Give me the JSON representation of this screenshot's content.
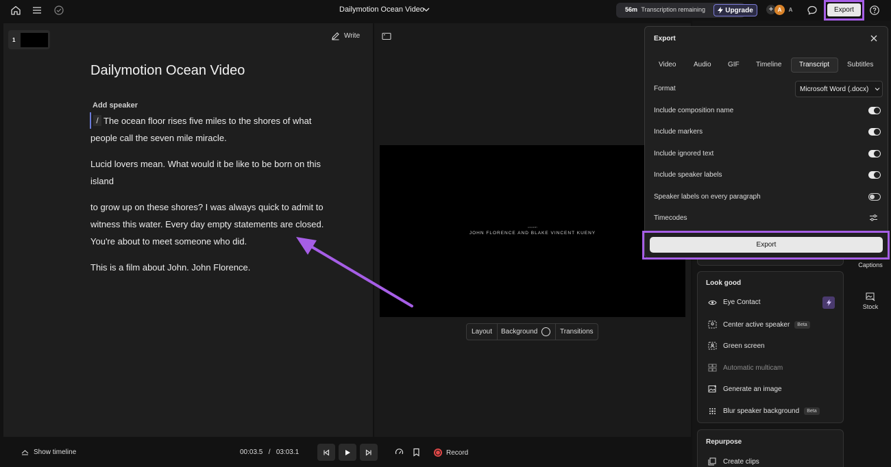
{
  "topbar": {
    "title": "Dailymotion Ocean Video",
    "transcription_minutes": "56m",
    "transcription_label": "Transcription remaining",
    "upgrade_label": "Upgrade",
    "avatar_plus": "+",
    "avatar_1": "A",
    "avatar_2": "A",
    "export_label": "Export",
    "icons": [
      "home-icon",
      "menu-icon",
      "check-circle-icon",
      "chevron-down-icon",
      "comment-icon",
      "help-icon"
    ]
  },
  "editor": {
    "scene_number": "1",
    "write_label": "Write",
    "title": "Dailymotion Ocean Video",
    "add_speaker": "Add speaker",
    "slash": "/",
    "paragraphs": [
      "The ocean floor rises five miles to the shores of what people call the seven mile miracle.",
      "Lucid lovers mean. What would it be like to be born on this island",
      "to grow up on these shores? I was always quick to admit to witness this water. Every day empty statements are closed. You're about to meet someone who did.",
      "This is a film about John. John Florence."
    ]
  },
  "preview": {
    "video_caption": "JOHN FLORENCE AND BLAKE VINCENT KUENY",
    "video_small_text": "A FILM BY",
    "toolbar": {
      "layout": "Layout",
      "background": "Background",
      "transitions": "Transitions"
    }
  },
  "bottombar": {
    "show_timeline": "Show timeline",
    "current_time": "00:03.5",
    "separator": "/",
    "total_time": "03:03.1",
    "record_label": "Record"
  },
  "export_panel": {
    "title": "Export",
    "tabs": [
      "Video",
      "Audio",
      "GIF",
      "Timeline",
      "Transcript",
      "Subtitles"
    ],
    "active_tab": "Transcript",
    "format_label": "Format",
    "format_value": "Microsoft Word (.docx)",
    "options": [
      {
        "label": "Include composition name",
        "on": true
      },
      {
        "label": "Include markers",
        "on": true
      },
      {
        "label": "Include ignored text",
        "on": true
      },
      {
        "label": "Include speaker labels",
        "on": true
      },
      {
        "label": "Speaker labels on every paragraph",
        "on": false
      }
    ],
    "timecodes_label": "Timecodes",
    "export_button": "Export"
  },
  "sidebar": {
    "look_good_title": "Look good",
    "look_good_items": [
      {
        "label": "Eye Contact",
        "icon": "eye-icon",
        "badge": ""
      },
      {
        "label": "Center active speaker",
        "icon": "speaker-icon",
        "badge": "Beta"
      },
      {
        "label": "Green screen",
        "icon": "green-screen-icon",
        "badge": ""
      },
      {
        "label": "Automatic multicam",
        "icon": "multicam-icon",
        "badge": ""
      },
      {
        "label": "Generate an image",
        "icon": "image-gen-icon",
        "badge": ""
      },
      {
        "label": "Blur speaker background",
        "icon": "blur-icon",
        "badge": "Beta"
      }
    ],
    "repurpose_title": "Repurpose",
    "repurpose_items": [
      {
        "label": "Create clips",
        "icon": "clips-icon"
      }
    ],
    "tools": [
      {
        "label": "Captions",
        "icon": "captions-icon"
      },
      {
        "label": "Stock",
        "icon": "stock-icon"
      }
    ]
  },
  "colors": {
    "accent_highlight": "#a65ee6",
    "annotation_arrow": "#a65ee6",
    "avatar": "#d9832a",
    "record": "#e04848"
  }
}
